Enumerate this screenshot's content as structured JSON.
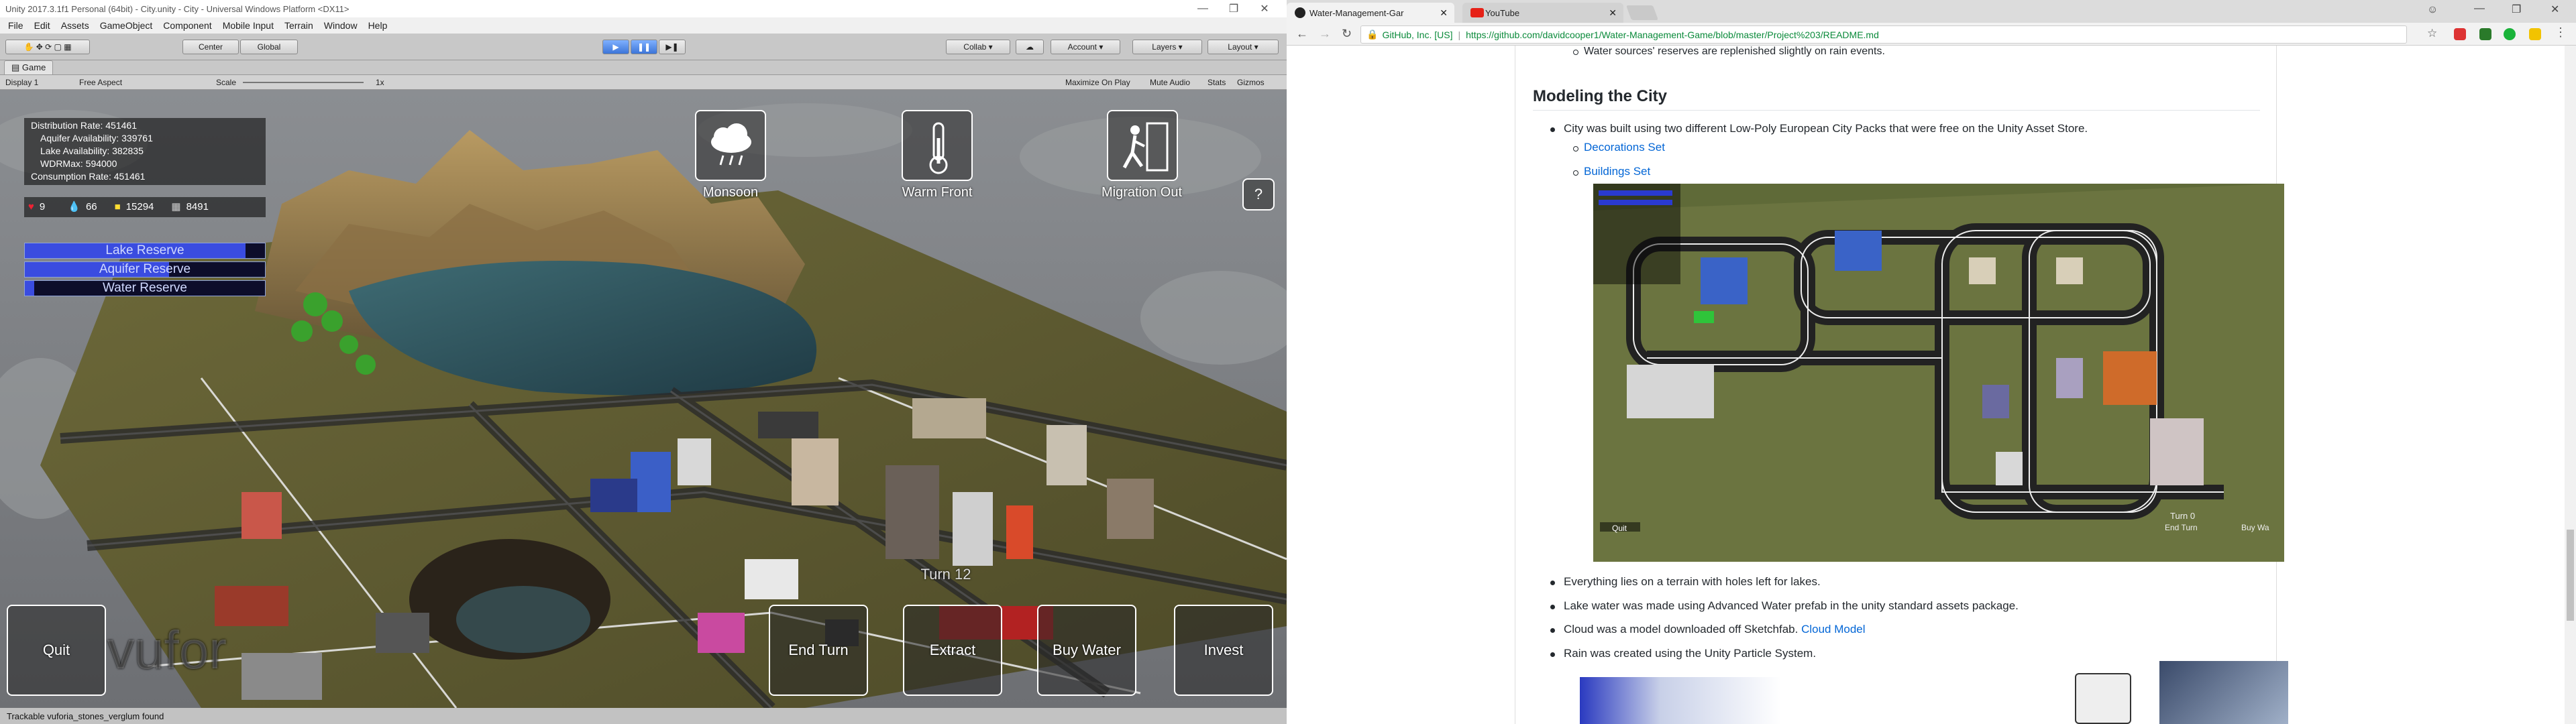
{
  "unity": {
    "title": "Unity 2017.3.1f1 Personal (64bit) - City.unity - City - Universal Windows Platform <DX11>",
    "menu": [
      "File",
      "Edit",
      "Assets",
      "GameObject",
      "Component",
      "Mobile Input",
      "Terrain",
      "Window",
      "Help"
    ],
    "toolbar": {
      "center": "Center",
      "global": "Global",
      "collab": "Collab",
      "account": "Account",
      "layers": "Layers",
      "layout": "Layout"
    },
    "tab": "Game",
    "gametoolbar": {
      "display": "Display 1",
      "aspect": "Free Aspect",
      "scale_label": "Scale",
      "scale_value": "1x",
      "maximize": "Maximize On Play",
      "mute": "Mute Audio",
      "stats": "Stats",
      "gizmos": "Gizmos"
    },
    "hud": {
      "stats": [
        "Distribution Rate: 451461",
        "Aquifer Availability: 339761",
        "Lake Availability: 382835",
        "WDRMax: 594000",
        "Consumption Rate: 451461"
      ],
      "counters": {
        "health": "9",
        "water": "66",
        "money": "15294",
        "other": "8491"
      },
      "bars": [
        {
          "label": "Lake Reserve",
          "level": 0.92
        },
        {
          "label": "Aquifer Reserve",
          "level": 0.6
        },
        {
          "label": "Water Reserve",
          "level": 0.04
        }
      ],
      "events": [
        {
          "label": "Monsoon",
          "icon": "cloud-rain-icon"
        },
        {
          "label": "Warm Front",
          "icon": "thermometer-icon"
        },
        {
          "label": "Migration Out",
          "icon": "exit-icon"
        }
      ],
      "help": "?",
      "turn": "Turn 12",
      "buttons": {
        "quit": "Quit",
        "end_turn": "End Turn",
        "extract": "Extract",
        "buy_water": "Buy Water",
        "invest": "Invest"
      },
      "watermark": "vufor"
    },
    "status": "Trackable vuforia_stones_verglum found"
  },
  "chrome": {
    "tabs": [
      {
        "title": "Water-Management-Gar"
      },
      {
        "title": "YouTube"
      }
    ],
    "site_badge": "GitHub, Inc. [US]",
    "url": "https://github.com/davidcooper1/Water-Management-Game/blob/master/Project%203/README.md",
    "readme": {
      "cut_line": "Water sources' reserves are replenished slightly on rain events.",
      "heading": "Modeling the City",
      "item1": "City was built using two different Low-Poly European City Packs that were free on the Unity Asset Store.",
      "links": [
        "Decorations Set",
        "Buildings Set"
      ],
      "shot": {
        "quit": "Quit",
        "turn": "Turn 0",
        "end_turn": "End Turn",
        "buy": "Buy Wa"
      },
      "item2": "Everything lies on a terrain with holes left for lakes.",
      "item3": "Lake water was made using Advanced Water prefab in the unity standard assets package.",
      "item4_prefix": "Cloud was a model downloaded off Sketchfab.",
      "item4_link": "Cloud Model",
      "item5": "Rain was created using the Unity Particle System."
    }
  }
}
